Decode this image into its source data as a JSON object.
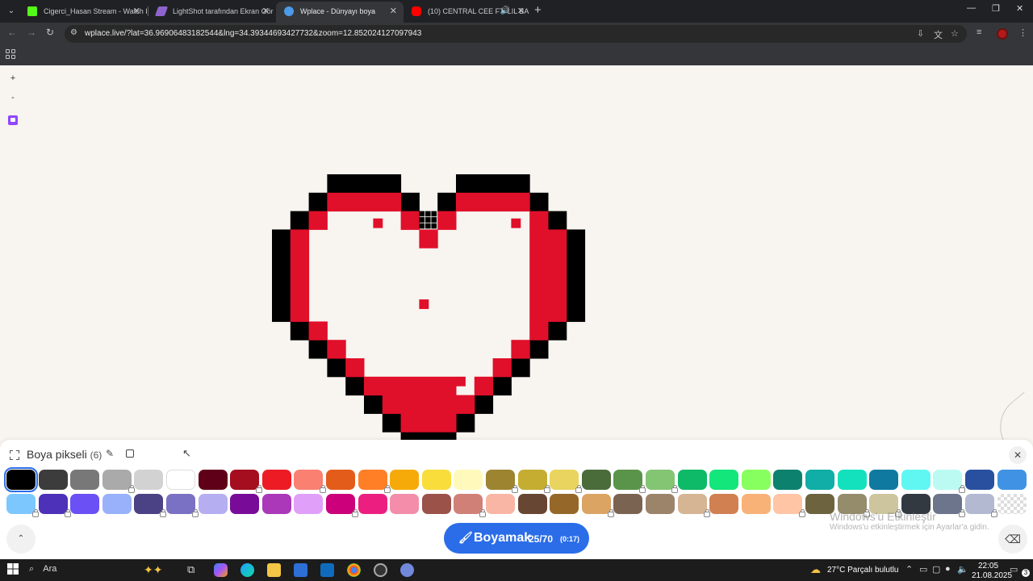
{
  "browser": {
    "tabs": [
      {
        "title": "Cigerci_Hasan Stream - Watch L",
        "favicon_color": "#53fc18",
        "active": false
      },
      {
        "title": "LightShot tarafından Ekran Gör",
        "favicon_color": "#8e63ce",
        "active": false
      },
      {
        "title": "Wplace - Dünyayı boya",
        "favicon_color": "#4c9be8",
        "active": true
      },
      {
        "title": "(10) CENTRAL CEE FT. LIL BA",
        "favicon_color": "#ff0000",
        "active": false
      }
    ],
    "url": "wplace.live/?lat=36.96906483182544&lng=34.39344693427732&zoom=12.852024127097943"
  },
  "map_controls": {
    "zoom_in": "+",
    "zoom_out": "-"
  },
  "canvas": {
    "colors": {
      "black": "#000000",
      "red": "#e0102a",
      "background": "#f8f4f0",
      "marker": "#000000"
    }
  },
  "paint_panel": {
    "title": "Boya pikseli",
    "count": "(6)",
    "button_label": "Boyamak",
    "button_count": "25/70",
    "button_timer": "(0:17)",
    "selected_color": "#000000",
    "palette_row1": [
      {
        "color": "#000000",
        "locked": false
      },
      {
        "color": "#3c3c3c",
        "locked": false
      },
      {
        "color": "#787878",
        "locked": false
      },
      {
        "color": "#aaaaaa",
        "locked": true
      },
      {
        "color": "#d2d2d2",
        "locked": false
      },
      {
        "color": "#ffffff",
        "locked": false
      },
      {
        "color": "#600018",
        "locked": false
      },
      {
        "color": "#a50e1e",
        "locked": true
      },
      {
        "color": "#ed1c24",
        "locked": false
      },
      {
        "color": "#fa8072",
        "locked": true
      },
      {
        "color": "#e45c1a",
        "locked": false
      },
      {
        "color": "#ff7f27",
        "locked": true
      },
      {
        "color": "#f6aa09",
        "locked": false
      },
      {
        "color": "#f9dd3b",
        "locked": false
      },
      {
        "color": "#fffabc",
        "locked": false
      },
      {
        "color": "#9c8431",
        "locked": true
      },
      {
        "color": "#c5ad31",
        "locked": true
      },
      {
        "color": "#e8d45f",
        "locked": true
      },
      {
        "color": "#4a6b3a",
        "locked": false
      },
      {
        "color": "#5a944a",
        "locked": true
      },
      {
        "color": "#84c573",
        "locked": true
      },
      {
        "color": "#0eb968",
        "locked": false
      },
      {
        "color": "#13e67b",
        "locked": false
      },
      {
        "color": "#87ff5e",
        "locked": false
      },
      {
        "color": "#0c816e",
        "locked": false
      },
      {
        "color": "#10aea6",
        "locked": false
      },
      {
        "color": "#13e1be",
        "locked": false
      },
      {
        "color": "#0f799f",
        "locked": false
      },
      {
        "color": "#60f7f2",
        "locked": false
      },
      {
        "color": "#bbfaf2",
        "locked": true
      },
      {
        "color": "#28509e",
        "locked": false
      },
      {
        "color": "#4093e4",
        "locked": false
      }
    ],
    "palette_row2": [
      {
        "color": "#7dc7ff",
        "locked": true
      },
      {
        "color": "#4d31b8",
        "locked": true
      },
      {
        "color": "#6b50f6",
        "locked": false
      },
      {
        "color": "#99b1fb",
        "locked": false
      },
      {
        "color": "#4a4284",
        "locked": true
      },
      {
        "color": "#7a71c4",
        "locked": true
      },
      {
        "color": "#b5aef1",
        "locked": false
      },
      {
        "color": "#780c99",
        "locked": false
      },
      {
        "color": "#aa38b9",
        "locked": false
      },
      {
        "color": "#e09ff9",
        "locked": false
      },
      {
        "color": "#cb007a",
        "locked": true
      },
      {
        "color": "#ec1f80",
        "locked": false
      },
      {
        "color": "#f38da9",
        "locked": false
      },
      {
        "color": "#9b5249",
        "locked": false
      },
      {
        "color": "#d18078",
        "locked": true
      },
      {
        "color": "#fab6a4",
        "locked": false
      },
      {
        "color": "#684634",
        "locked": false
      },
      {
        "color": "#95682a",
        "locked": false
      },
      {
        "color": "#dba463",
        "locked": true
      },
      {
        "color": "#7b6352",
        "locked": false
      },
      {
        "color": "#9c846b",
        "locked": false
      },
      {
        "color": "#d6b594",
        "locked": true
      },
      {
        "color": "#d18051",
        "locked": false
      },
      {
        "color": "#f8b277",
        "locked": false
      },
      {
        "color": "#ffc5a5",
        "locked": true
      },
      {
        "color": "#6d643f",
        "locked": false
      },
      {
        "color": "#948c6b",
        "locked": true
      },
      {
        "color": "#cdc59e",
        "locked": true
      },
      {
        "color": "#333941",
        "locked": false
      },
      {
        "color": "#6d758d",
        "locked": true
      },
      {
        "color": "#b3b9d1",
        "locked": true
      },
      {
        "color": "transparent",
        "locked": false
      }
    ]
  },
  "activation_watermark": {
    "line1": "Windows'u Etkinleştir",
    "line2": "Windows'u etkinleştirmek için Ayarlar'a gidin."
  },
  "taskbar": {
    "search_label": "Ara",
    "weather": "27°C  Parçalı bulutlu",
    "time": "22:05",
    "date": "21.08.2025",
    "notifications": "3"
  }
}
